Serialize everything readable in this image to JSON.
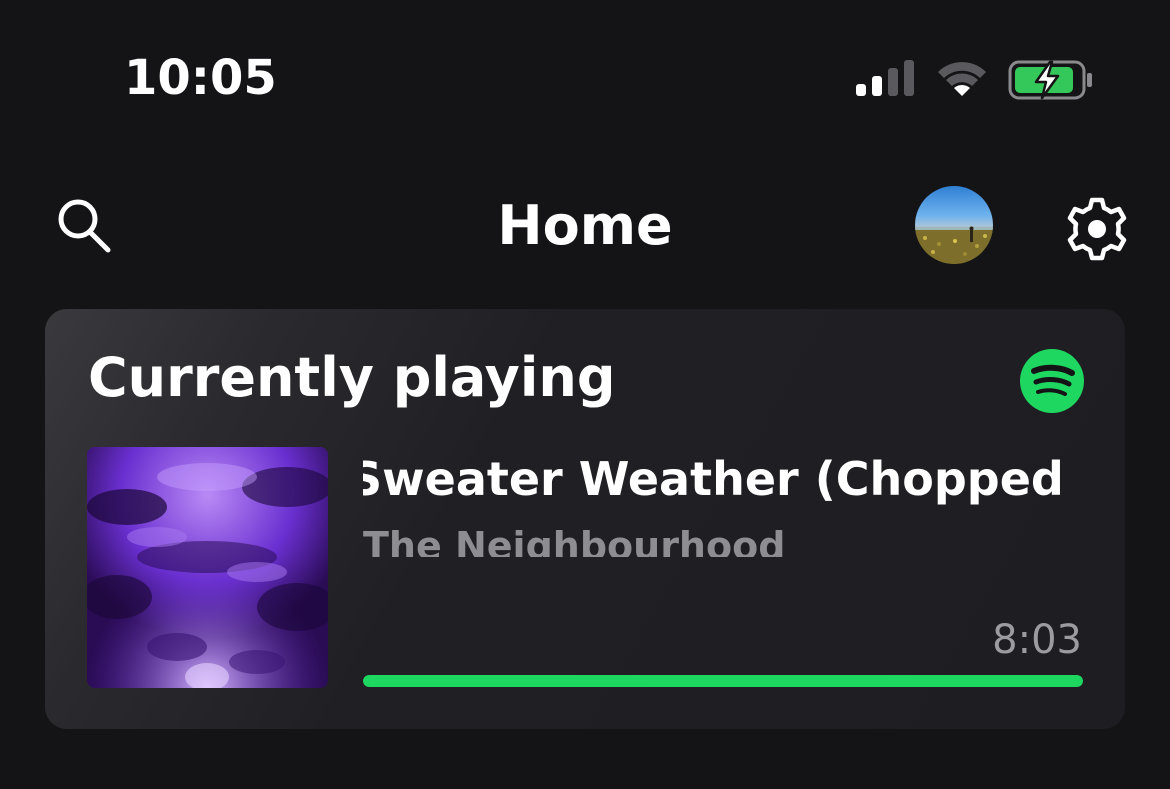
{
  "status_bar": {
    "time": "10:05",
    "icons": [
      "cellular-signal-icon",
      "wifi-icon",
      "battery-charging-icon"
    ]
  },
  "header": {
    "title": "Home",
    "icons": [
      "search-icon",
      "avatar",
      "gear-icon"
    ]
  },
  "now_playing": {
    "section_title": "Currently playing",
    "source_icon": "spotify-icon",
    "track_title": "Sweater Weather (Chopped Not Slopped)",
    "artist": "The Neighbourhood",
    "duration": "8:03",
    "progress": 1.0
  },
  "colors": {
    "background": "#141416",
    "card": "#1e1e22",
    "accent_green": "#1ed760",
    "secondary_text": "#8d8d92",
    "album_purple": "#6a2fd0"
  }
}
